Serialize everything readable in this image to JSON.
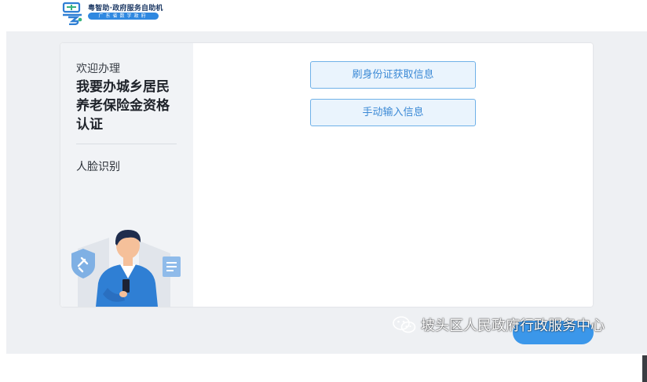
{
  "header": {
    "brand_name": "粤智助·政府服务自助机",
    "brand_tagline": "广东省数字政府"
  },
  "sidebar": {
    "welcome": "欢迎办理",
    "service_title": "我要办城乡居民养老保险金资格认证",
    "current_step": "人脸识别"
  },
  "options": {
    "id_card": "刷身份证获取信息",
    "manual_input": "手动输入信息"
  },
  "watermark": {
    "text": "坡头区人民政府行政服务中心"
  },
  "colors": {
    "accent": "#3b97ea",
    "button_border": "#6fb1e8",
    "button_text": "#3c8ad6",
    "stage_bg": "#eef0f3",
    "sidebar_bg": "#f1f3f6"
  }
}
